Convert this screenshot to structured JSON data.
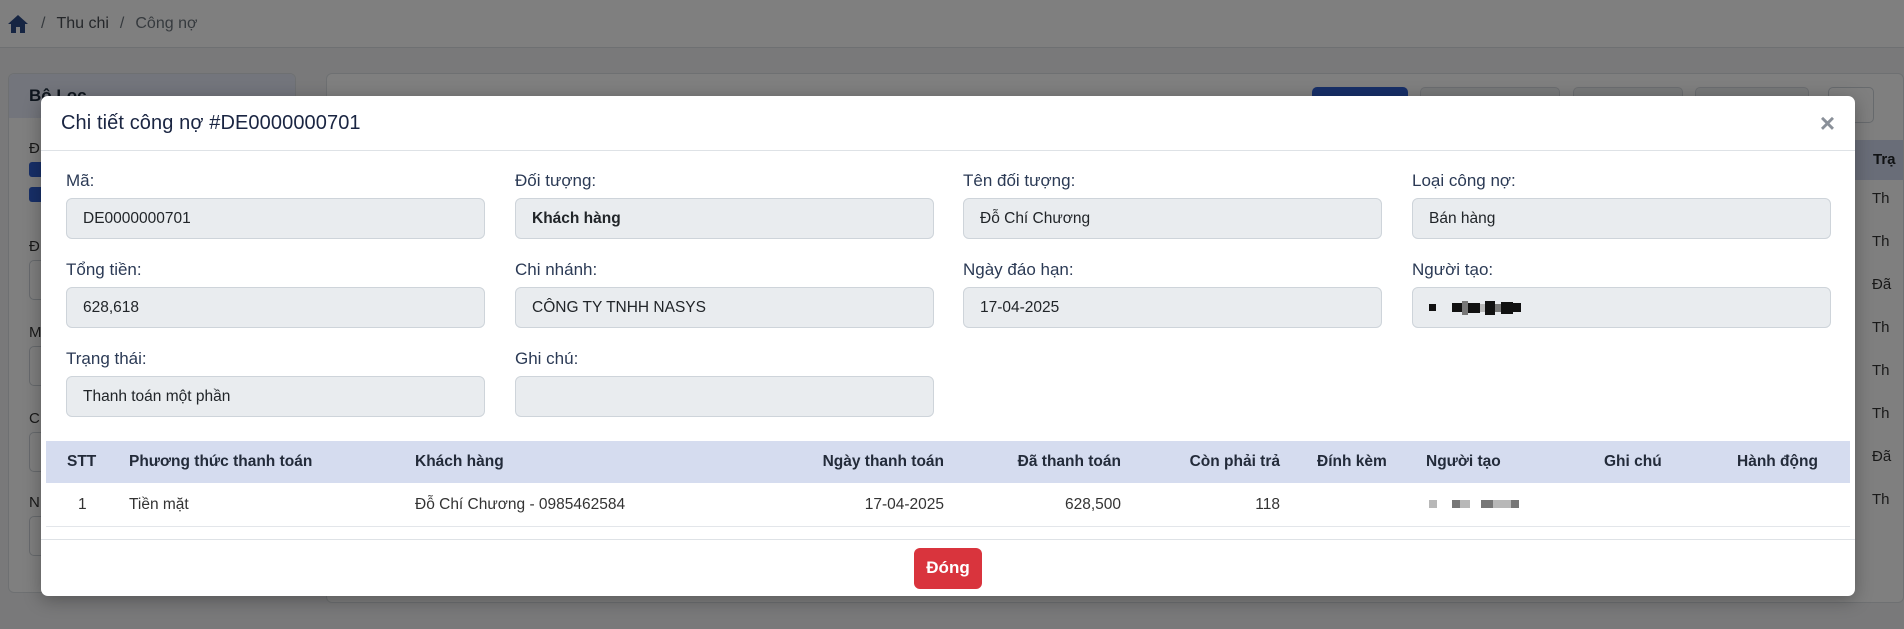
{
  "breadcrumb": {
    "items": [
      "Thu chi",
      "Công nợ"
    ]
  },
  "filter": {
    "title": "Bộ Lọc",
    "letters": [
      "Đ",
      "Đ",
      "M",
      "C",
      "N"
    ]
  },
  "main": {
    "header_cell": "Trạ",
    "row_cells": [
      "Th",
      "Th",
      "Đã",
      "Th",
      "Th",
      "Th",
      "Đã",
      "Th"
    ]
  },
  "modal": {
    "title": "Chi tiết công nợ #DE0000000701",
    "fields": {
      "ma": {
        "label": "Mã:",
        "value": "DE0000000701"
      },
      "doi_tuong": {
        "label": "Đối tượng:",
        "value": "Khách hàng"
      },
      "ten_doi_tuong": {
        "label": "Tên đối tượng:",
        "value": "Đỗ Chí Chương"
      },
      "loai_cong_no": {
        "label": "Loại công nợ:",
        "value": "Bán hàng"
      },
      "tong_tien": {
        "label": "Tổng tiền:",
        "value": "628,618"
      },
      "chi_nhanh": {
        "label": "Chi nhánh:",
        "value": "CÔNG TY TNHH NASYS"
      },
      "ngay_dao_han": {
        "label": "Ngày đáo hạn:",
        "value": "17-04-2025"
      },
      "nguoi_tao": {
        "label": "Người tạo:",
        "value": ""
      },
      "trang_thai": {
        "label": "Trạng thái:",
        "value": "Thanh toán một phần"
      },
      "ghi_chu": {
        "label": "Ghi chú:",
        "value": ""
      }
    },
    "table": {
      "headers": [
        "STT",
        "Phương thức thanh toán",
        "Khách hàng",
        "Ngày thanh toán",
        "Đã thanh toán",
        "Còn phải trả",
        "Đính kèm",
        "Người tạo",
        "Ghi chú",
        "Hành động"
      ],
      "rows": [
        {
          "stt": "1",
          "phuong_thuc": "Tiền mặt",
          "khach_hang": "Đỗ Chí Chương - 0985462584",
          "ngay": "17-04-2025",
          "da_thanh_toan": "628,500",
          "con_phai_tra": "118",
          "dinh_kem": "",
          "nguoi_tao": "",
          "ghi_chu": "",
          "hanh_dong": ""
        }
      ]
    },
    "close_button": "Đóng"
  },
  "colors": {
    "close_button": "#d9343d",
    "table_header": "#d5dcef",
    "primary": "#2f5fd0"
  }
}
